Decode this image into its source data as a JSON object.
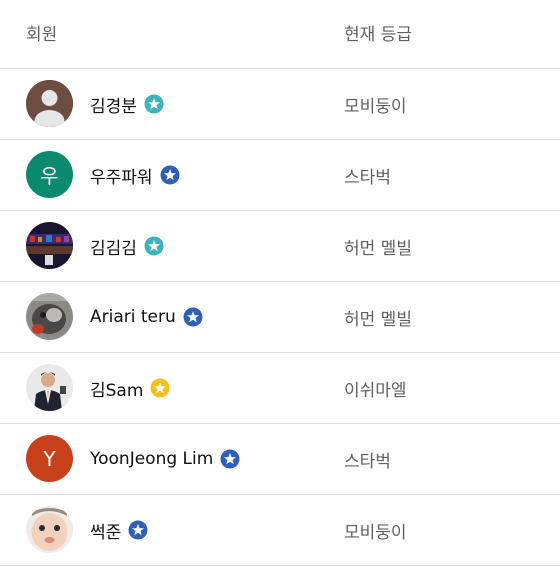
{
  "header": {
    "member": "회원",
    "grade": "현재 등급"
  },
  "colors": {
    "teal_badge": "#3ab3bf",
    "blue_badge": "#2f5fb7",
    "gold_badge": "#f4c01e"
  },
  "members": [
    {
      "name": "김경분",
      "grade": "모비둥이",
      "avatar": "default-person-avatar",
      "badge": "teal-star-badge"
    },
    {
      "name": "우주파워",
      "grade": "스타벅",
      "avatar_letter": "우",
      "avatar_color": "#0b8a6e",
      "badge": "blue-star-badge"
    },
    {
      "name": "김김김",
      "grade": "허먼 멜빌",
      "avatar": "concert-photo-avatar",
      "badge": "teal-star-badge"
    },
    {
      "name": "Ariari teru",
      "grade": "허먼 멜빌",
      "avatar": "cat-photo-avatar",
      "badge": "blue-star-badge"
    },
    {
      "name": "김Sam",
      "grade": "이쉬마엘",
      "avatar": "man-in-suit-avatar",
      "badge": "gold-star-badge"
    },
    {
      "name": "YoonJeong Lim",
      "grade": "스타벅",
      "avatar_letter": "Y",
      "avatar_color": "#c6401a",
      "badge": "blue-star-badge"
    },
    {
      "name": "썩준",
      "grade": "모비둥이",
      "avatar": "baby-photo-avatar",
      "badge": "blue-star-badge"
    }
  ]
}
